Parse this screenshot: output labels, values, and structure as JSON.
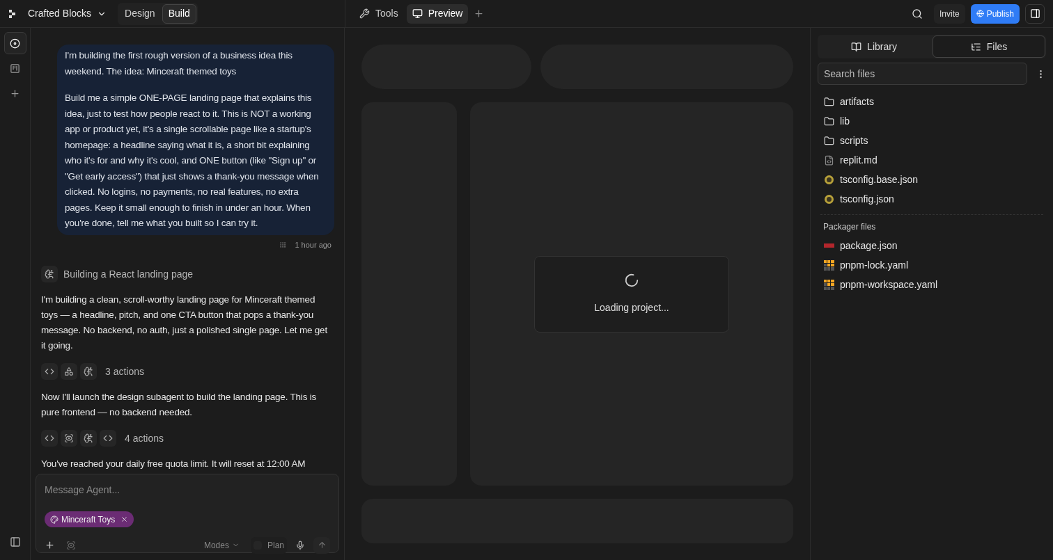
{
  "header": {
    "project": "Crafted Blocks",
    "modes": [
      {
        "label": "Design",
        "selected": false
      },
      {
        "label": "Build",
        "selected": true
      }
    ],
    "tabs": [
      {
        "kind": "tools",
        "label": "Tools",
        "selected": false
      },
      {
        "kind": "preview",
        "label": "Preview",
        "selected": true
      }
    ],
    "invite": "Invite",
    "publish": "Publish"
  },
  "rail": [
    {
      "kind": "agent",
      "selected": true
    },
    {
      "kind": "board",
      "selected": false
    },
    {
      "kind": "add",
      "selected": false
    }
  ],
  "chat": {
    "user_message": {
      "paragraphs": [
        "I'm building the first rough version of a business idea this weekend. The idea: Minceraft themed toys",
        "Build me a simple ONE-PAGE landing page that explains this idea, just to test how people react to it. This is NOT a working app or product yet, it's a single scrollable page like a startup's homepage: a headline saying what it is, a short bit explaining who it's for and why it's cool, and ONE button (like \"Sign up\" or \"Get early access\") that just shows a thank-you message when clicked. No logins, no payments, no real features, no extra pages. Keep it small enough to finish in under an hour. When you're done, tell me what you built so I can try it."
      ],
      "time": "1 hour ago"
    },
    "messages": [
      {
        "kind": "status",
        "text": "Building a React landing page"
      },
      {
        "kind": "text",
        "text": "I'm building a clean, scroll-worthy landing page for Minceraft themed toys — a headline, pitch, and one CTA button that pops a thank-you message. No backend, no auth, just a polished single page. Let me get it going."
      },
      {
        "kind": "actions",
        "icons": [
          {
            "kind": "code"
          },
          {
            "kind": "shapes"
          },
          {
            "kind": "brain"
          }
        ],
        "text": "3 actions"
      },
      {
        "kind": "text",
        "text": "Now I'll launch the design subagent to build the landing page. This is pure frontend — no backend needed."
      },
      {
        "kind": "actions",
        "icons": [
          {
            "kind": "code"
          },
          {
            "kind": "scan"
          },
          {
            "kind": "brain"
          },
          {
            "kind": "code"
          }
        ],
        "text": "4 actions"
      },
      {
        "kind": "text",
        "text": "You've reached your daily free quota limit. It will reset at 12:00 AM"
      }
    ]
  },
  "composer": {
    "placeholder": "Message Agent...",
    "attachment": "Minceraft Toys",
    "modes": "Modes",
    "plan": {
      "label": "Plan",
      "on": false
    }
  },
  "preview": {
    "loading": "Loading project..."
  },
  "files": {
    "tabs": [
      {
        "kind": "library",
        "label": "Library",
        "selected": false
      },
      {
        "kind": "files",
        "label": "Files",
        "selected": true
      }
    ],
    "search_placeholder": "Search files",
    "items": [
      {
        "kind": "folder",
        "name": "artifacts"
      },
      {
        "kind": "folder",
        "name": "lib"
      },
      {
        "kind": "folder",
        "name": "scripts"
      },
      {
        "kind": "markdown",
        "name": "replit.md"
      },
      {
        "kind": "tsconfig",
        "name": "tsconfig.base.json"
      },
      {
        "kind": "tsconfig",
        "name": "tsconfig.json"
      }
    ],
    "packager_title": "Packager files",
    "packager": [
      {
        "kind": "npm",
        "name": "package.json"
      },
      {
        "kind": "pnpm",
        "name": "pnpm-lock.yaml"
      },
      {
        "kind": "pnpm",
        "name": "pnpm-workspace.yaml"
      }
    ]
  }
}
